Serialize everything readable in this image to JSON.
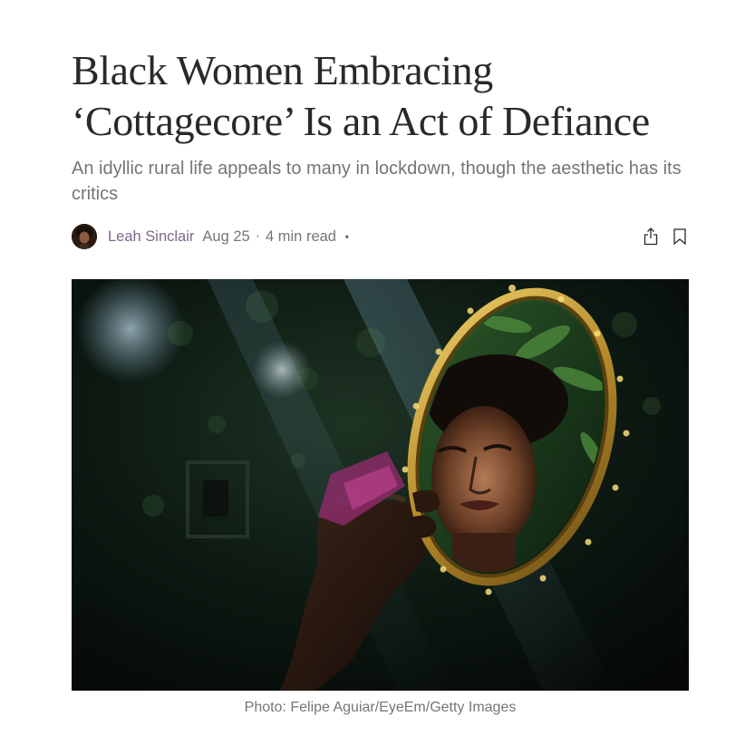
{
  "article": {
    "title_line1": "Black Women Embracing",
    "title_line2": "‘Cottagecore’ Is an Act of Defiance",
    "subtitle": "An idyllic rural life appeals to many in lockdown, though the aesthetic has its critics"
  },
  "byline": {
    "author": "Leah Sinclair",
    "date": "Aug 25",
    "separator": "·",
    "read_time": "4 min read",
    "member_mark": "⋆"
  },
  "icons": {
    "avatar": "author-avatar",
    "share": "share-icon",
    "bookmark": "bookmark-icon",
    "star": "member-star-icon"
  },
  "image": {
    "caption": "Photo: Felipe Aguiar/EyeEm/Getty Images"
  },
  "colors": {
    "title": "#292929",
    "subtitle": "#757575",
    "author": "#7a6a8a"
  }
}
